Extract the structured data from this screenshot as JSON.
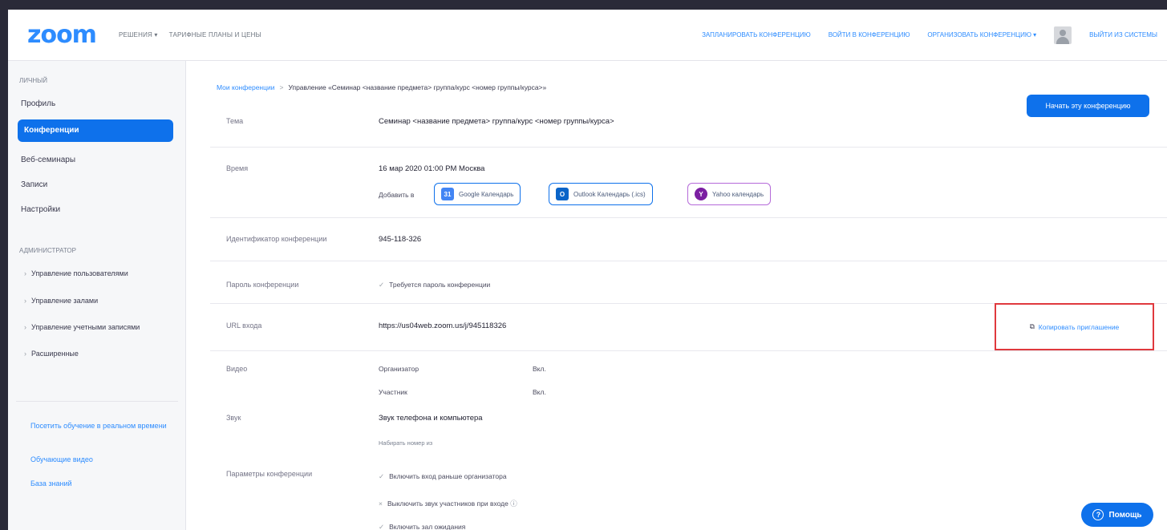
{
  "header": {
    "logo": "zoom",
    "nav_left": [
      "РЕШЕНИЯ ▾",
      "ТАРИФНЫЕ ПЛАНЫ И ЦЕНЫ"
    ],
    "schedule": "ЗАПЛАНИРОВАТЬ КОНФЕРЕНЦИЮ",
    "join": "ВОЙТИ В КОНФЕРЕНЦИЮ",
    "host": "ОРГАНИЗОВАТЬ КОНФЕРЕНЦИЮ ▾",
    "signout": "ВЫЙТИ ИЗ СИСТЕМЫ"
  },
  "sidebar": {
    "personal_label": "ЛИЧНЫЙ",
    "items": [
      "Профиль",
      "Конференции",
      "Веб-семинары",
      "Записи",
      "Настройки"
    ],
    "admin_label": "АДМИНИСТРАТОР",
    "admin_items": [
      "Управление пользователями",
      "Управление залами",
      "Управление учетными записями",
      "Расширенные"
    ],
    "links": [
      "Посетить обучение в реальном времени",
      "Обучающие видео",
      "База знаний"
    ]
  },
  "breadcrumb": {
    "link": "Мои конференции",
    "current": "Управление «Семинар <название предмета> группа/курс <номер группы/курса>»"
  },
  "start_button": "Начать эту конференцию",
  "rows": {
    "topic_label": "Тема",
    "topic_value": "Семинар <название предмета> группа/курс <номер группы/курса>",
    "time_label": "Время",
    "time_value": "16 мар 2020 01:00 PM Москва",
    "add_to": "Добавить в",
    "calendars": [
      "Google Календарь",
      "Outlook Календарь (.ics)",
      "Yahoo календарь"
    ],
    "id_label": "Идентификатор конференции",
    "id_value": "945-118-326",
    "password_label": "Пароль конференции",
    "password_value": "Требуется пароль конференции",
    "url_label": "URL входа",
    "url_value": "https://us04web.zoom.us/j/945118326",
    "copy_invite": "Копировать приглашение",
    "video_label": "Видео",
    "video_host": "Организатор",
    "video_host_val": "Вкл.",
    "video_part": "Участник",
    "video_part_val": "Вкл.",
    "audio_label": "Звук",
    "audio_value": "Звук телефона и компьютера",
    "dial_in": "Набирать номер из",
    "options_label": "Параметры конференции",
    "options": [
      "Включить вход раньше организатора",
      "Выключить звук участников при входе",
      "Включить зал ожидания"
    ]
  },
  "help_button": "Помощь",
  "colors": {
    "accent": "#0e71eb",
    "link": "#2d8cff",
    "highlight": "#e0393e"
  }
}
